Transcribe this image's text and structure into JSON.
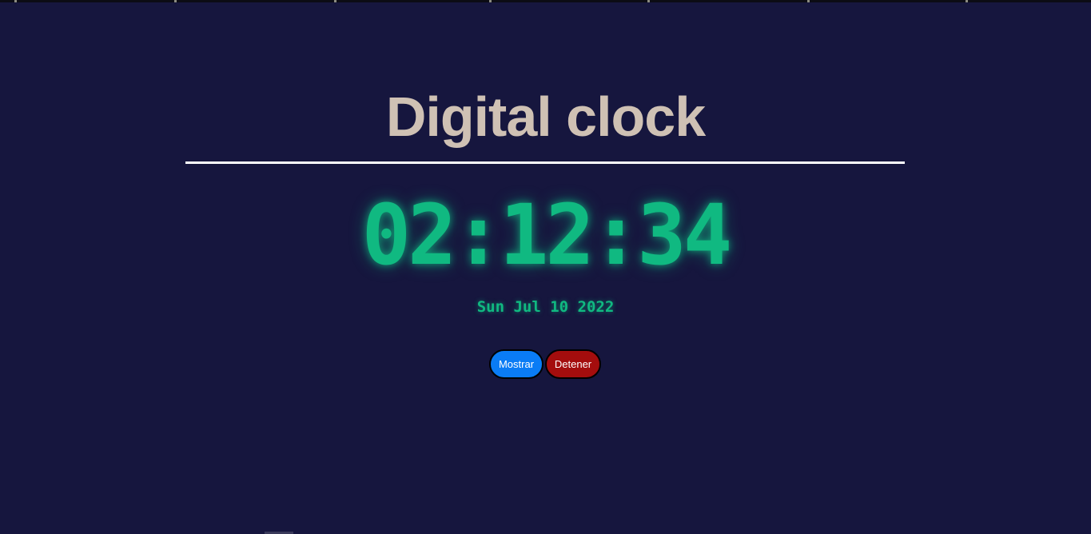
{
  "page": {
    "title": "Digital clock"
  },
  "clock": {
    "time": "02:12:34",
    "date": "Sun Jul 10 2022"
  },
  "buttons": {
    "show_label": "Mostrar",
    "stop_label": "Detener"
  },
  "colors": {
    "background": "#16163e",
    "title": "#cfc1b4",
    "clock_green": "#10b981",
    "show_button": "#0a7cf5",
    "stop_button": "#a40d0d"
  }
}
